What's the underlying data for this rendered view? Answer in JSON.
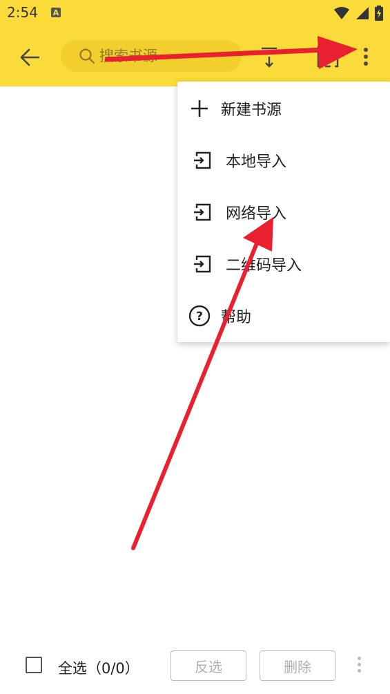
{
  "status_bar": {
    "time": "2:54",
    "badge": "A"
  },
  "toolbar": {
    "search_placeholder": "搜索书源"
  },
  "menu": {
    "items": [
      {
        "label": "新建书源",
        "icon": "plus-icon"
      },
      {
        "label": "本地导入",
        "icon": "import-icon"
      },
      {
        "label": "网络导入",
        "icon": "import-icon"
      },
      {
        "label": "二维码导入",
        "icon": "import-icon"
      },
      {
        "label": "帮助",
        "icon": "help-icon"
      }
    ]
  },
  "bottom_bar": {
    "select_all": "全选（0/0）",
    "invert": "反选",
    "delete": "删除"
  },
  "colors": {
    "accent": "#fbdb3a",
    "arrow": "#e8202f"
  }
}
